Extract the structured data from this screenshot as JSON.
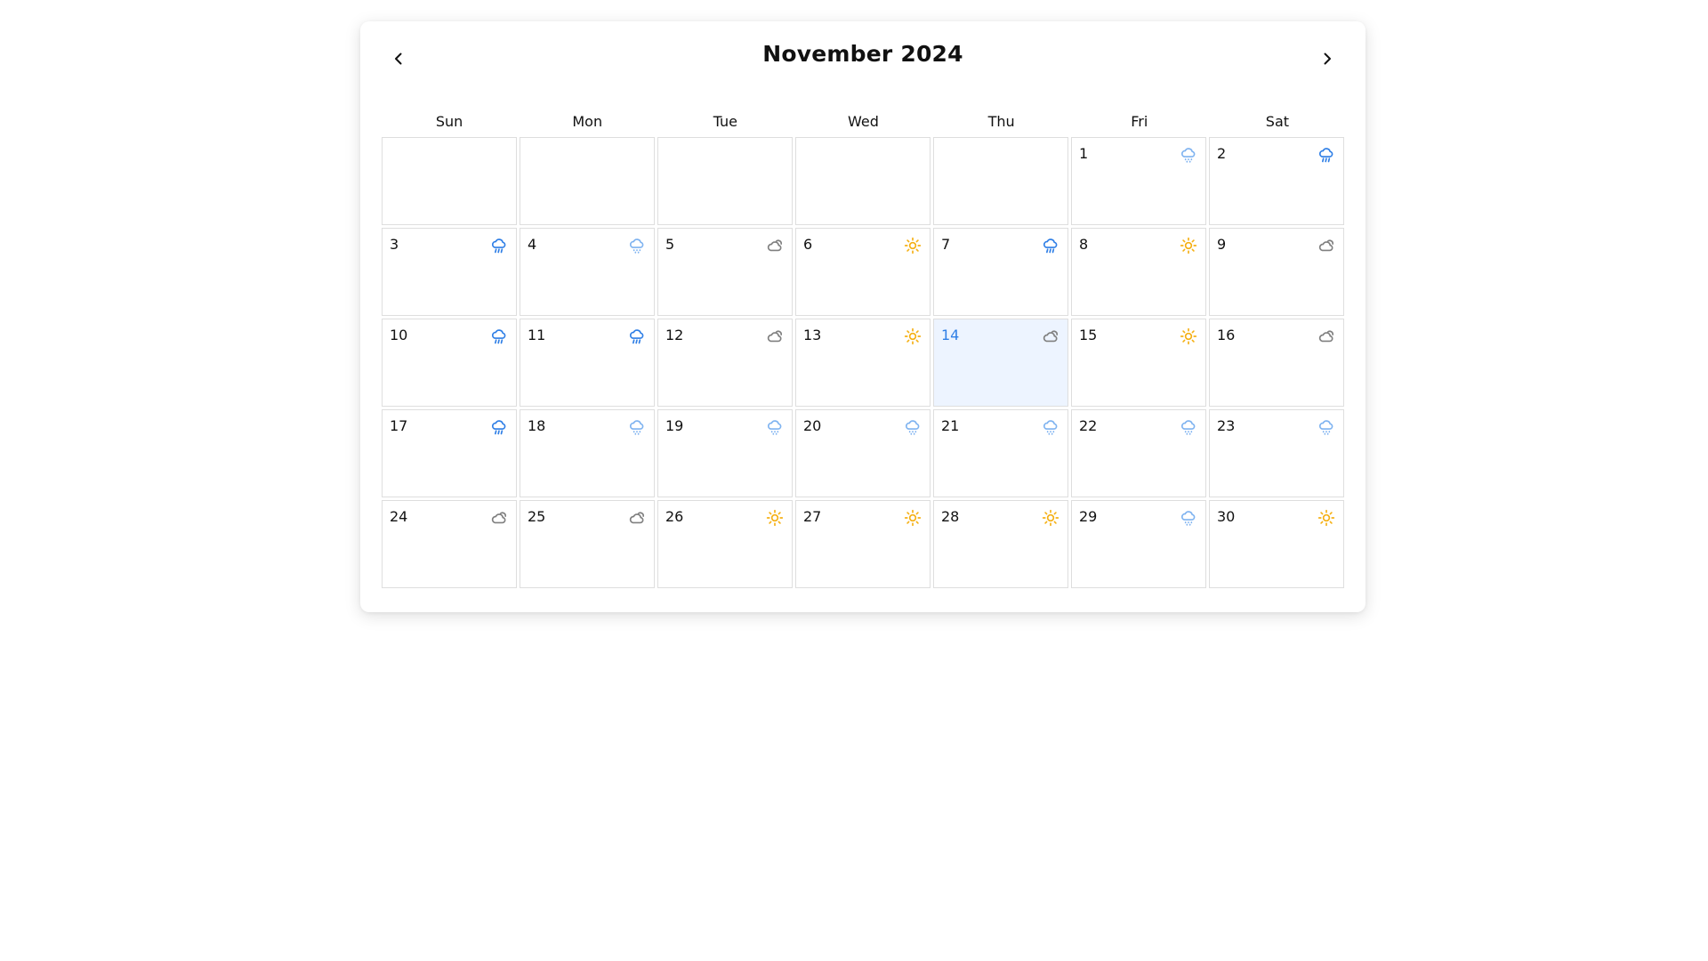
{
  "calendar": {
    "title": "November 2024",
    "prev_icon": "chevron-left-icon",
    "next_icon": "chevron-right-icon",
    "weekdays": [
      "Sun",
      "Mon",
      "Tue",
      "Wed",
      "Thu",
      "Fri",
      "Sat"
    ],
    "leading_empty_cells": 5,
    "today": "14",
    "colors": {
      "accent": "#2f7fe6",
      "today_bg": "#edf4ff",
      "sun": "#f5b014",
      "heavy_rain": "#2f7fe6",
      "drizzle": "#7fb3f0",
      "cloud": "#808080"
    },
    "days": [
      {
        "day": "1",
        "weather": "drizzle-icon"
      },
      {
        "day": "2",
        "weather": "heavy-rain-icon"
      },
      {
        "day": "3",
        "weather": "heavy-rain-icon"
      },
      {
        "day": "4",
        "weather": "drizzle-icon"
      },
      {
        "day": "5",
        "weather": "cloud-icon"
      },
      {
        "day": "6",
        "weather": "sun-icon"
      },
      {
        "day": "7",
        "weather": "heavy-rain-icon"
      },
      {
        "day": "8",
        "weather": "sun-icon"
      },
      {
        "day": "9",
        "weather": "cloud-icon"
      },
      {
        "day": "10",
        "weather": "heavy-rain-icon"
      },
      {
        "day": "11",
        "weather": "heavy-rain-icon"
      },
      {
        "day": "12",
        "weather": "cloud-icon"
      },
      {
        "day": "13",
        "weather": "sun-icon"
      },
      {
        "day": "14",
        "weather": "cloud-icon"
      },
      {
        "day": "15",
        "weather": "sun-icon"
      },
      {
        "day": "16",
        "weather": "cloud-icon"
      },
      {
        "day": "17",
        "weather": "heavy-rain-icon"
      },
      {
        "day": "18",
        "weather": "drizzle-icon"
      },
      {
        "day": "19",
        "weather": "drizzle-icon"
      },
      {
        "day": "20",
        "weather": "drizzle-icon"
      },
      {
        "day": "21",
        "weather": "drizzle-icon"
      },
      {
        "day": "22",
        "weather": "drizzle-icon"
      },
      {
        "day": "23",
        "weather": "drizzle-icon"
      },
      {
        "day": "24",
        "weather": "cloud-icon"
      },
      {
        "day": "25",
        "weather": "cloud-icon"
      },
      {
        "day": "26",
        "weather": "sun-icon"
      },
      {
        "day": "27",
        "weather": "sun-icon"
      },
      {
        "day": "28",
        "weather": "sun-icon"
      },
      {
        "day": "29",
        "weather": "drizzle-icon"
      },
      {
        "day": "30",
        "weather": "sun-icon"
      }
    ]
  }
}
